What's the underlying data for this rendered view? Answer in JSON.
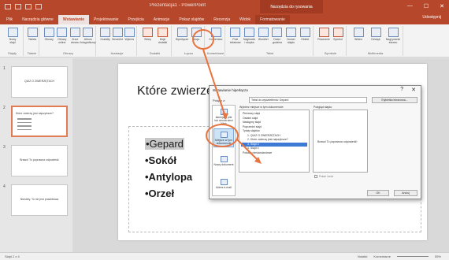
{
  "app": {
    "title": "Prezentacja1 - PowerPoint",
    "context_tab_title": "Narzędzia do rysowania",
    "window_controls": [
      "—",
      "☐",
      "✕"
    ]
  },
  "ribbon_tabs": [
    {
      "label": "Plik",
      "active": false
    },
    {
      "label": "Narzędzia główne",
      "active": false
    },
    {
      "label": "Wstawianie",
      "active": true
    },
    {
      "label": "Projektowanie",
      "active": false
    },
    {
      "label": "Przejścia",
      "active": false
    },
    {
      "label": "Animacje",
      "active": false
    },
    {
      "label": "Pokaz slajdów",
      "active": false
    },
    {
      "label": "Recenzja",
      "active": false
    },
    {
      "label": "Widok",
      "active": false
    },
    {
      "label": "Formatowanie",
      "active": false,
      "contextual": true
    }
  ],
  "share_label": "Udostępnij",
  "ribbon_groups": [
    {
      "label": "Slajdy",
      "buttons": [
        "Nowy slajd"
      ]
    },
    {
      "label": "Tabele",
      "buttons": [
        "Tabela"
      ]
    },
    {
      "label": "Obrazy",
      "buttons": [
        "Obrazy",
        "Obrazy online",
        "Zrzut ekranu",
        "Album fotograficzny"
      ]
    },
    {
      "label": "Ilustracje",
      "buttons": [
        "Kształty",
        "SmartArt",
        "Wykres"
      ]
    },
    {
      "label": "Dodatki",
      "buttons": [
        "Sklep",
        "Moje dodatki"
      ]
    },
    {
      "label": "Łącza",
      "buttons": [
        "Hiperłącze",
        "Akcja"
      ]
    },
    {
      "label": "Komentarze",
      "buttons": [
        "Komentarz"
      ]
    },
    {
      "label": "Tekst",
      "buttons": [
        "Pole tekstowe",
        "Nagłówek i stopka",
        "WordArt",
        "Data i godzina",
        "Numer slajdu",
        "Obiekt"
      ]
    },
    {
      "label": "Symbole",
      "buttons": [
        "Równanie",
        "Symbol"
      ]
    },
    {
      "label": "Multimedia",
      "buttons": [
        "Wideo",
        "Dźwięk",
        "Nagrywanie ekranu"
      ]
    }
  ],
  "thumbnails": [
    {
      "number": "1",
      "text": "QUIZ O ZWIERZĘTACH"
    },
    {
      "number": "2",
      "text": "Które zwierzę jest najszybsze?"
    },
    {
      "number": "3",
      "text": "Brawo! To poprawna odpowiedź"
    },
    {
      "number": "4",
      "text": "Niestety. To nie jest prawidłowa"
    }
  ],
  "slide": {
    "title": "Które zwierzę",
    "bullets": [
      "•Gepard",
      "•Sokół",
      "•Antylopa",
      "•Orzeł"
    ]
  },
  "dialog": {
    "title": "Wstawianie hiperłącza",
    "controls": [
      "?",
      "✕"
    ],
    "link_to_label": "Połącz z:",
    "text_label": "Tekst do wyświetlenia:",
    "text_value": "Gepard",
    "screentip_button": "Etykietka ekranowa...",
    "left_items": [
      {
        "label": "Istniejący plik lub strona sieci Web",
        "selected": false
      },
      {
        "label": "Miejsce w tym dokumencie",
        "selected": true
      },
      {
        "label": "Nowy dokument",
        "selected": false
      },
      {
        "label": "Adres e-mail",
        "selected": false
      }
    ],
    "list_label": "Wybierz miejsce w tym dokumencie:",
    "list_items": [
      {
        "text": "Pierwszy slajd",
        "selected": false
      },
      {
        "text": "Ostatni slajd",
        "selected": false
      },
      {
        "text": "Następny slajd",
        "selected": false
      },
      {
        "text": "Poprzedni slajd",
        "selected": false
      },
      {
        "text": "Tytuły slajdów",
        "selected": false
      },
      {
        "text": "1. QUIZ O ZWIERZĘTACH",
        "selected": false
      },
      {
        "text": "2. Które zwierzę jest najszybsze?",
        "selected": false
      },
      {
        "text": "3. Slajd 3",
        "selected": true
      },
      {
        "text": "4. Slajd 4",
        "selected": false
      },
      {
        "text": "Pokazy niestandardowe",
        "selected": false
      }
    ],
    "preview_label": "Podgląd slajdu:",
    "preview_text": "Brawo! To poprawna odpowiedź!",
    "show_return_label": "Pokaż i wróć",
    "ok_label": "OK",
    "cancel_label": "Anuluj"
  },
  "status": {
    "slide_info": "Slajd 2 z 4",
    "notes": "Notatki",
    "comments": "Komentarze",
    "zoom": "55%"
  },
  "colors": {
    "accent": "#b7472a",
    "annotation": "#e9743f",
    "selection": "#3d7ad6"
  }
}
